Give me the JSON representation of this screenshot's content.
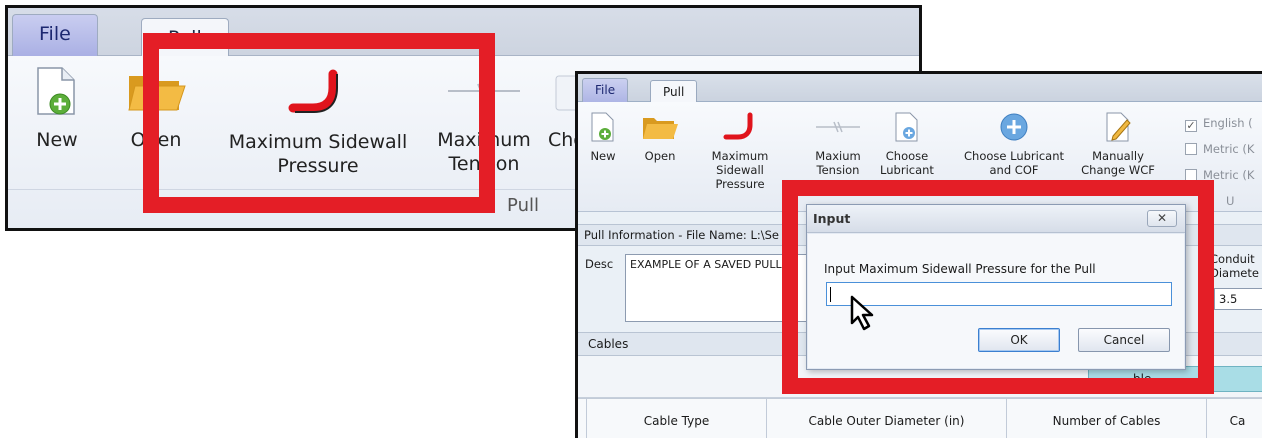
{
  "zoom": {
    "tabs": [
      {
        "label": "File"
      },
      {
        "label": "Pull"
      }
    ],
    "buttons": [
      {
        "label": "New",
        "icon": "new-document-icon"
      },
      {
        "label": "Open",
        "icon": "folder-icon"
      },
      {
        "label": "Maximum Sidewall Pressure",
        "icon": "pipe-bend-icon"
      },
      {
        "label": "Maximum Tension",
        "icon": "tension-icon"
      },
      {
        "label": "Choose Lubricant",
        "icon": "lubricant-icon"
      }
    ],
    "group_label": "Pull"
  },
  "app": {
    "tabs": [
      {
        "label": "File"
      },
      {
        "label": "Pull"
      }
    ],
    "buttons": [
      {
        "label": "New",
        "icon": "new-document-icon"
      },
      {
        "label": "Open",
        "icon": "folder-icon"
      },
      {
        "label": "Maximum Sidewall Pressure",
        "icon": "pipe-bend-icon"
      },
      {
        "label": "Maxium Tension",
        "icon": "tension-icon"
      },
      {
        "label": "Choose Lubricant",
        "icon": "lubricant-icon"
      },
      {
        "label": "Choose Lubricant and COF",
        "icon": "add-icon"
      },
      {
        "label": "Manually Change WCF",
        "icon": "pencil-icon"
      }
    ],
    "units": [
      {
        "label": "English (",
        "checked": true
      },
      {
        "label": "Metric (K",
        "checked": false
      },
      {
        "label": "Metric (K",
        "checked": false
      }
    ],
    "units_group_label": "U",
    "info_bar": "Pull Information - File Name: L:\\Se",
    "desc_label": "Desc",
    "desc_value": "EXAMPLE OF A SAVED PULL",
    "conduit_label": "Conduit Diamete",
    "conduit_value": "3.5",
    "cables_label": "Cables",
    "teal_cell_label": "ble",
    "columns": [
      {
        "label": "Cable Type"
      },
      {
        "label": "Cable Outer Diameter (in)"
      },
      {
        "label": "Number of Cables"
      },
      {
        "label": "Ca"
      }
    ]
  },
  "dialog": {
    "title": "Input",
    "close_label": "✕",
    "prompt": "Input Maximum Sidewall Pressure for the Pull",
    "value": "",
    "ok_label": "OK",
    "cancel_label": "Cancel"
  },
  "colors": {
    "highlight": "#e41e26",
    "ribbon_bg": "#eef2f8",
    "accent_blue": "#4a90d9"
  }
}
